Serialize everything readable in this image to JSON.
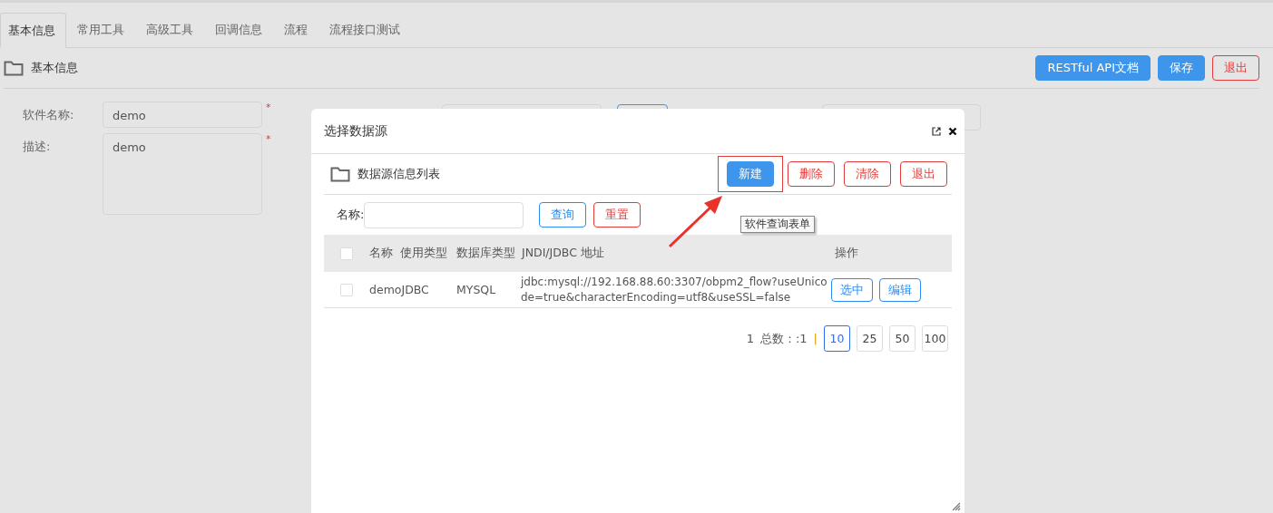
{
  "tabs": [
    {
      "label": "基本信息",
      "selected": true
    },
    {
      "label": "常用工具",
      "selected": false
    },
    {
      "label": "高级工具",
      "selected": false
    },
    {
      "label": "回调信息",
      "selected": false
    },
    {
      "label": "流程",
      "selected": false
    },
    {
      "label": "流程接口测试",
      "selected": false
    }
  ],
  "header": {
    "title": "基本信息",
    "buttons": [
      {
        "label": "RESTful API文档",
        "kind": "primary"
      },
      {
        "label": "保存",
        "kind": "primary"
      },
      {
        "label": "退出",
        "kind": "danger"
      }
    ]
  },
  "form": {
    "name_label": "软件名称:",
    "name_value": "demo",
    "desc_label": "描述:",
    "desc_value": "demo",
    "required_mark": "*"
  },
  "dialog": {
    "title": "选择数据源",
    "section_title": "数据源信息列表",
    "toolbar": [
      {
        "label": "新建",
        "kind": "primary",
        "highlighted": true
      },
      {
        "label": "删除",
        "kind": "danger",
        "highlighted": false
      },
      {
        "label": "清除",
        "kind": "danger",
        "highlighted": false
      },
      {
        "label": "退出",
        "kind": "danger",
        "highlighted": false
      }
    ],
    "search": {
      "label": "名称:",
      "buttons": [
        {
          "label": "查询",
          "kind": "outline"
        },
        {
          "label": "重置",
          "kind": "danger"
        }
      ]
    },
    "tooltip": "软件查询表单",
    "table": {
      "header_checked": false,
      "columns": [
        "名称",
        "使用类型",
        "数据库类型",
        "JNDI/JDBC 地址",
        "操作"
      ],
      "rows": [
        {
          "checked": false,
          "name": "demoJDBC",
          "db_type": "MYSQL",
          "address": "jdbc:mysql://192.168.88.60:3307/obpm2_flow?useUnicode=true&characterEncoding=utf8&useSSL=false",
          "actions": [
            {
              "label": "选中",
              "kind": "outline"
            },
            {
              "label": "编辑",
              "kind": "outline"
            }
          ]
        }
      ]
    },
    "pagination": {
      "page": "1",
      "total": "总数：:1",
      "separator": "|",
      "sizes": [
        {
          "label": "10",
          "selected": true
        },
        {
          "label": "25",
          "selected": false
        },
        {
          "label": "50",
          "selected": false
        },
        {
          "label": "100",
          "selected": false
        }
      ]
    }
  }
}
